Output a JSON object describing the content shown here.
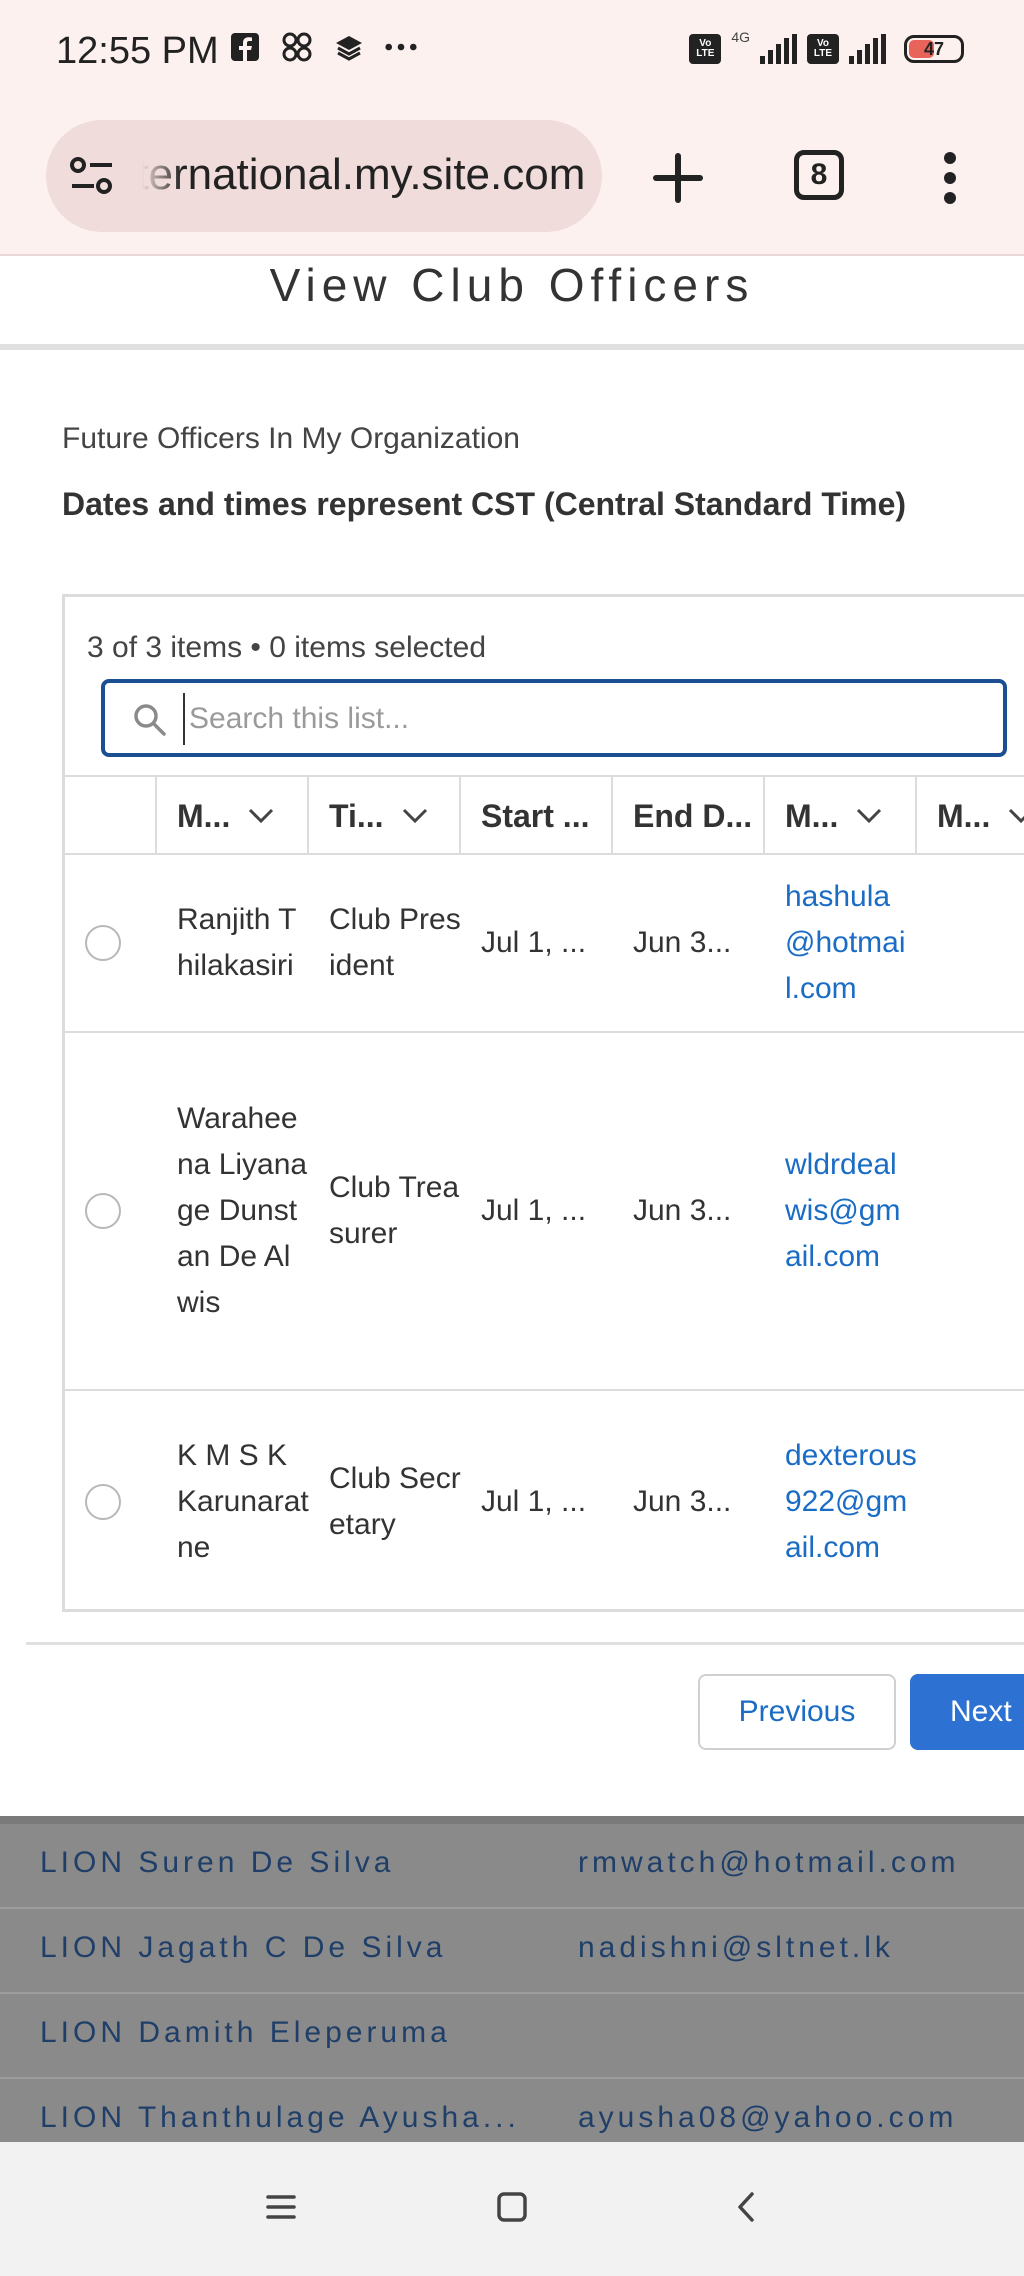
{
  "status_bar": {
    "time": "12:55 PM",
    "network": "4G",
    "volte": "Vo LTE",
    "battery": "47",
    "icons": [
      "facebook-icon",
      "apps-icon",
      "layers-icon",
      "more-dots-icon"
    ]
  },
  "browser": {
    "url": "international.my.site.com",
    "tab_count": "8"
  },
  "page": {
    "title": "View Club Officers",
    "section_label": "Future Officers In My Organization",
    "timezone_note": "Dates and times represent CST (Central Standard Time)"
  },
  "list": {
    "count_text": "3 of 3 items • 0 items selected",
    "search_placeholder": "Search this list...",
    "columns": [
      "M...",
      "Ti...",
      "Start ...",
      "End D...",
      "M...",
      "M..."
    ],
    "rows": [
      {
        "name": "Ranjith Thilakasiri",
        "title": "Club President",
        "start": "Jul 1, ...",
        "end": "Jun 3...",
        "email": "hashula@hotmail.com"
      },
      {
        "name": "Waraheena Liyanage Dunstan De Alwis",
        "title": "Club Treasurer",
        "start": "Jul 1, ...",
        "end": "Jun 3...",
        "email": "wldrdealwis@gmail.com"
      },
      {
        "name": "K M S K Karunaratne",
        "title": "Club Secretary",
        "start": "Jul 1, ...",
        "end": "Jun 3...",
        "email": "dexterous922@gmail.com"
      }
    ]
  },
  "pagination": {
    "previous_label": "Previous",
    "next_label": "Next"
  },
  "background_list": [
    {
      "name": "LION Suren De Silva",
      "email": "rmwatch@hotmail.com"
    },
    {
      "name": "LION Jagath C De Silva",
      "email": "nadishni@sltnet.lk"
    },
    {
      "name": "LION Damith Eleperuma",
      "email": ""
    },
    {
      "name": "LION Thanthulage Ayusha...",
      "email": "ayusha08@yahoo.com"
    }
  ],
  "colors": {
    "accent": "#2d72d2",
    "link": "#1a6cc4",
    "focus_border": "#1b4f91",
    "browser_bg": "#fdf1ef"
  }
}
